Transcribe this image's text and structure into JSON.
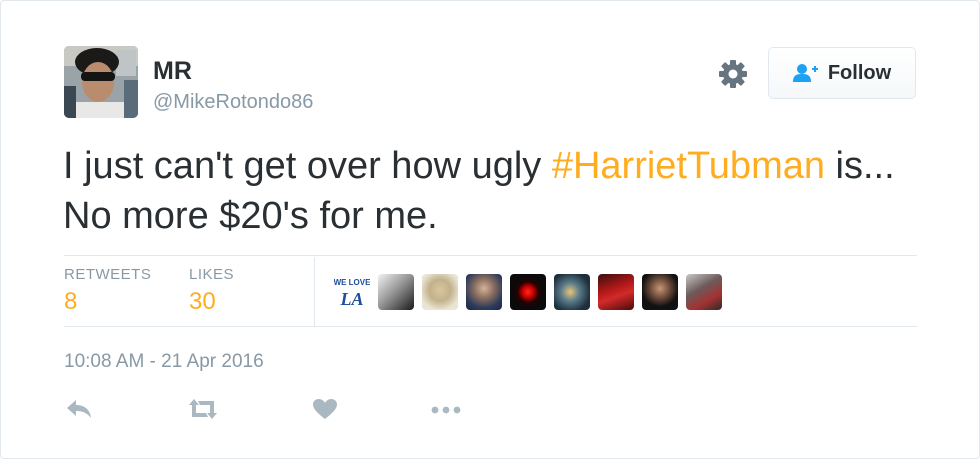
{
  "user": {
    "name": "MR",
    "handle": "@MikeRotondo86"
  },
  "follow_button": {
    "label": "Follow"
  },
  "tweet": {
    "text_before": "I just can't get over how ugly ",
    "hashtag": "#HarrietTubman",
    "text_after": " is... No more $20's for me."
  },
  "stats": {
    "retweets_label": "RETWEETS",
    "retweets_count": "8",
    "likes_label": "LIKES",
    "likes_count": "30"
  },
  "likers": [
    {
      "name": "liker-avatar-dodgers",
      "logo_text": "WE LOVE LA"
    },
    {
      "name": "liker-avatar-2"
    },
    {
      "name": "liker-avatar-3"
    },
    {
      "name": "liker-avatar-4"
    },
    {
      "name": "liker-avatar-5"
    },
    {
      "name": "liker-avatar-6"
    },
    {
      "name": "liker-avatar-7"
    },
    {
      "name": "liker-avatar-8"
    },
    {
      "name": "liker-avatar-9"
    }
  ],
  "timestamp": "10:08 AM - 21 Apr 2016",
  "colors": {
    "accent": "#ffad1f",
    "text": "#292f33",
    "muted": "#8899a6",
    "border": "#e1e8ed",
    "follow_icon": "#1da1f2",
    "action_icon": "#aab8c2"
  },
  "icons": {
    "settings": "gear-icon",
    "follow": "person-add-icon",
    "reply": "reply-icon",
    "retweet": "retweet-icon",
    "like": "heart-icon",
    "more": "more-icon"
  }
}
